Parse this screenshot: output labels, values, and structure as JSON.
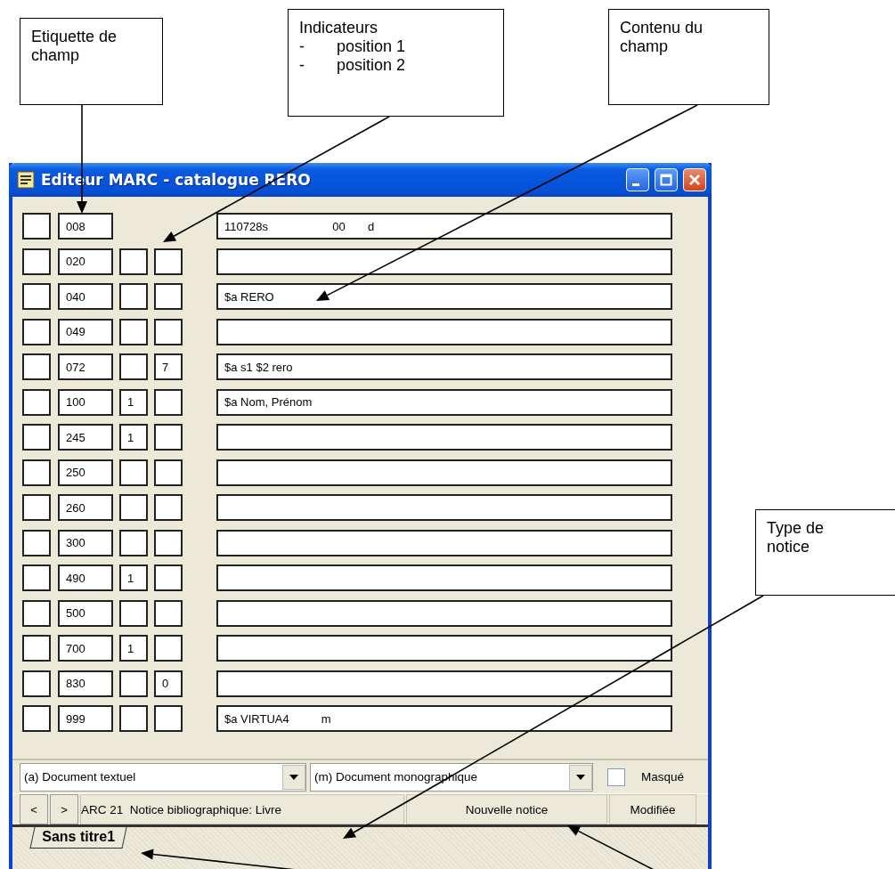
{
  "callouts": [
    {
      "text": "Etiquette de champ"
    },
    {
      "text": "Indicateurs",
      "items": [
        {
          "marker": "-",
          "text": "position 1"
        },
        {
          "marker": "-",
          "text": "position 2"
        }
      ]
    },
    {
      "text": "Contenu du champ"
    },
    {
      "text": "Type de notice"
    }
  ],
  "window": {
    "title": "Editeur MARC - catalogue RERO"
  },
  "fields": [
    {
      "kind": "control",
      "tag": "008",
      "content": "110728s                    00       d"
    },
    {
      "kind": "data",
      "tag": "020"
    },
    {
      "kind": "data",
      "tag": "040",
      "content": "$a RERO"
    },
    {
      "kind": "data",
      "tag": "049"
    },
    {
      "kind": "data",
      "tag": "072",
      "ind2": "7",
      "content": "$a s1 $2 rero"
    },
    {
      "kind": "data",
      "tag": "100",
      "ind1": "1",
      "content": "$a Nom, Prénom"
    },
    {
      "kind": "data",
      "tag": "245",
      "ind1": "1"
    },
    {
      "kind": "data",
      "tag": "250"
    },
    {
      "kind": "data",
      "tag": "260"
    },
    {
      "kind": "data",
      "tag": "300"
    },
    {
      "kind": "data",
      "tag": "490",
      "ind1": "1"
    },
    {
      "kind": "data",
      "tag": "500"
    },
    {
      "kind": "data",
      "tag": "700",
      "ind1": "1"
    },
    {
      "kind": "data",
      "tag": "830",
      "ind2": "0"
    },
    {
      "kind": "data",
      "tag": "999",
      "content": "$a VIRTUA4          m"
    }
  ],
  "selectors": [
    {
      "value": "(a) Document textuel"
    },
    {
      "value": "(m) Document monographique"
    }
  ],
  "masked": {
    "label": "Masqué",
    "checked": false
  },
  "status_bar": {
    "prev": "<",
    "next": ">",
    "format": "ARC 21  Notice bibliographique: Livre",
    "record": "Nouvelle notice",
    "state": "Modifiée"
  },
  "tabs": [
    {
      "label": "Sans titre1",
      "selected": true
    }
  ]
}
